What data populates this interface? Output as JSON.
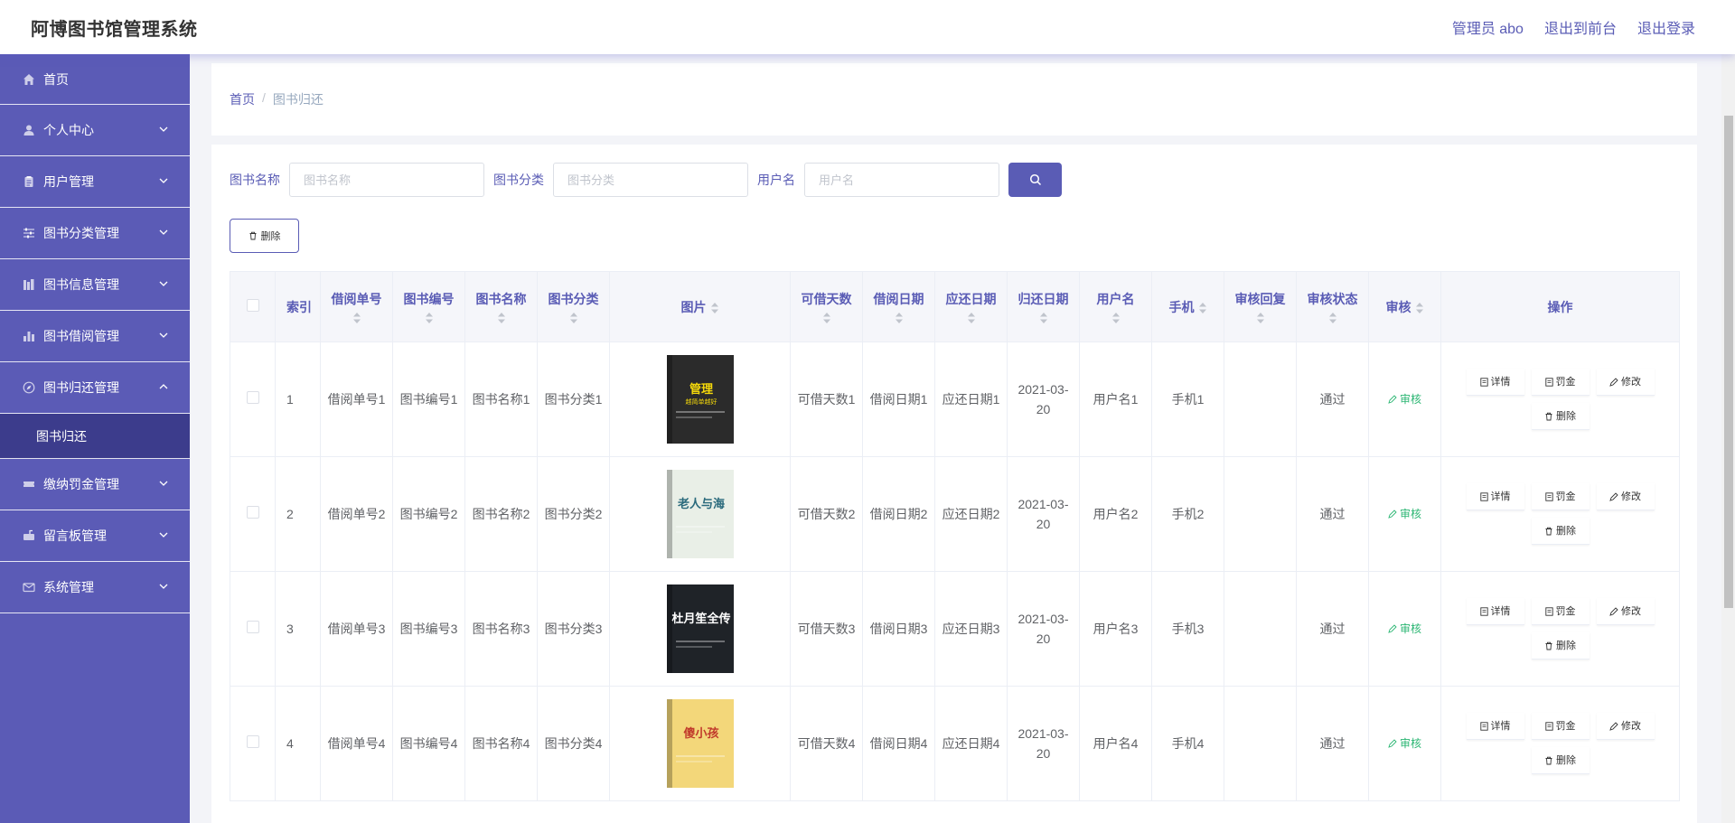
{
  "app": {
    "title": "阿博图书馆管理系统"
  },
  "top_links": {
    "admin": "管理员 abo",
    "front": "退出到前台",
    "logout": "退出登录"
  },
  "sidebar": {
    "items": [
      {
        "label": "首页",
        "icon": "home-icon"
      },
      {
        "label": "个人中心",
        "icon": "user-icon"
      },
      {
        "label": "用户管理",
        "icon": "clipboard-icon"
      },
      {
        "label": "图书分类管理",
        "icon": "sliders-icon"
      },
      {
        "label": "图书信息管理",
        "icon": "library-icon"
      },
      {
        "label": "图书借阅管理",
        "icon": "bar-chart-icon"
      },
      {
        "label": "图书归还管理",
        "icon": "compass-icon",
        "expanded": true
      },
      {
        "label": "缴纳罚金管理",
        "icon": "ticket-icon"
      },
      {
        "label": "留言板管理",
        "icon": "mailbox-icon"
      },
      {
        "label": "系统管理",
        "icon": "mail-icon"
      }
    ],
    "sub_item": "图书归还"
  },
  "breadcrumb": {
    "home": "首页",
    "sep": "/",
    "current": "图书归还"
  },
  "search": {
    "book_name_label": "图书名称",
    "book_name_placeholder": "图书名称",
    "category_label": "图书分类",
    "category_placeholder": "图书分类",
    "username_label": "用户名",
    "username_placeholder": "用户名"
  },
  "toolbar": {
    "delete_label": "删除"
  },
  "table": {
    "headers": {
      "index": "索引",
      "borrow_no": "借阅单号",
      "book_no": "图书编号",
      "book_name": "图书名称",
      "category": "图书分类",
      "image": "图片",
      "days": "可借天数",
      "borrow_date": "借阅日期",
      "due_date": "应还日期",
      "return_date": "归还日期",
      "username": "用户名",
      "phone": "手机",
      "reply": "审核回复",
      "status": "审核状态",
      "audit": "审核",
      "ops": "操作"
    },
    "rows": [
      {
        "index": "1",
        "borrow_no": "借阅单号1",
        "book_no": "图书编号1",
        "book_name": "图书名称1",
        "category": "图书分类1",
        "days": "可借天数1",
        "borrow_date": "借阅日期1",
        "due_date": "应还日期1",
        "return_date": "2021-03-20",
        "username": "用户名1",
        "phone": "手机1",
        "reply": "",
        "status": "通过"
      },
      {
        "index": "2",
        "borrow_no": "借阅单号2",
        "book_no": "图书编号2",
        "book_name": "图书名称2",
        "category": "图书分类2",
        "days": "可借天数2",
        "borrow_date": "借阅日期2",
        "due_date": "应还日期2",
        "return_date": "2021-03-20",
        "username": "用户名2",
        "phone": "手机2",
        "reply": "",
        "status": "通过"
      },
      {
        "index": "3",
        "borrow_no": "借阅单号3",
        "book_no": "图书编号3",
        "book_name": "图书名称3",
        "category": "图书分类3",
        "days": "可借天数3",
        "borrow_date": "借阅日期3",
        "due_date": "应还日期3",
        "return_date": "2021-03-20",
        "username": "用户名3",
        "phone": "手机3",
        "reply": "",
        "status": "通过"
      },
      {
        "index": "4",
        "borrow_no": "借阅单号4",
        "book_no": "图书编号4",
        "book_name": "图书名称4",
        "category": "图书分类4",
        "days": "可借天数4",
        "borrow_date": "借阅日期4",
        "due_date": "应还日期4",
        "return_date": "2021-03-20",
        "username": "用户名4",
        "phone": "手机4",
        "reply": "",
        "status": "通过"
      }
    ],
    "audit_label": "审核",
    "op_labels": {
      "detail": "详情",
      "fine": "罚金",
      "edit": "修改",
      "delete": "删除"
    },
    "covers": [
      {
        "title": "管理",
        "subtitle": "越简单越好",
        "bg": "#2b2b2b",
        "fg": "#f5d90a"
      },
      {
        "title": "老人与海",
        "subtitle": "",
        "bg": "#e9efe7",
        "fg": "#2a6a7c"
      },
      {
        "title": "杜月笙全传",
        "subtitle": "",
        "bg": "#1f2328",
        "fg": "#ffffff"
      },
      {
        "title": "傻小孩",
        "subtitle": "",
        "bg": "#f3d77a",
        "fg": "#c0392b"
      }
    ]
  },
  "colors": {
    "accent": "#5a5cb5",
    "sidebar": "#5b5bb6",
    "sidebar_active": "#3c3c8c",
    "audit": "#2bb673"
  }
}
